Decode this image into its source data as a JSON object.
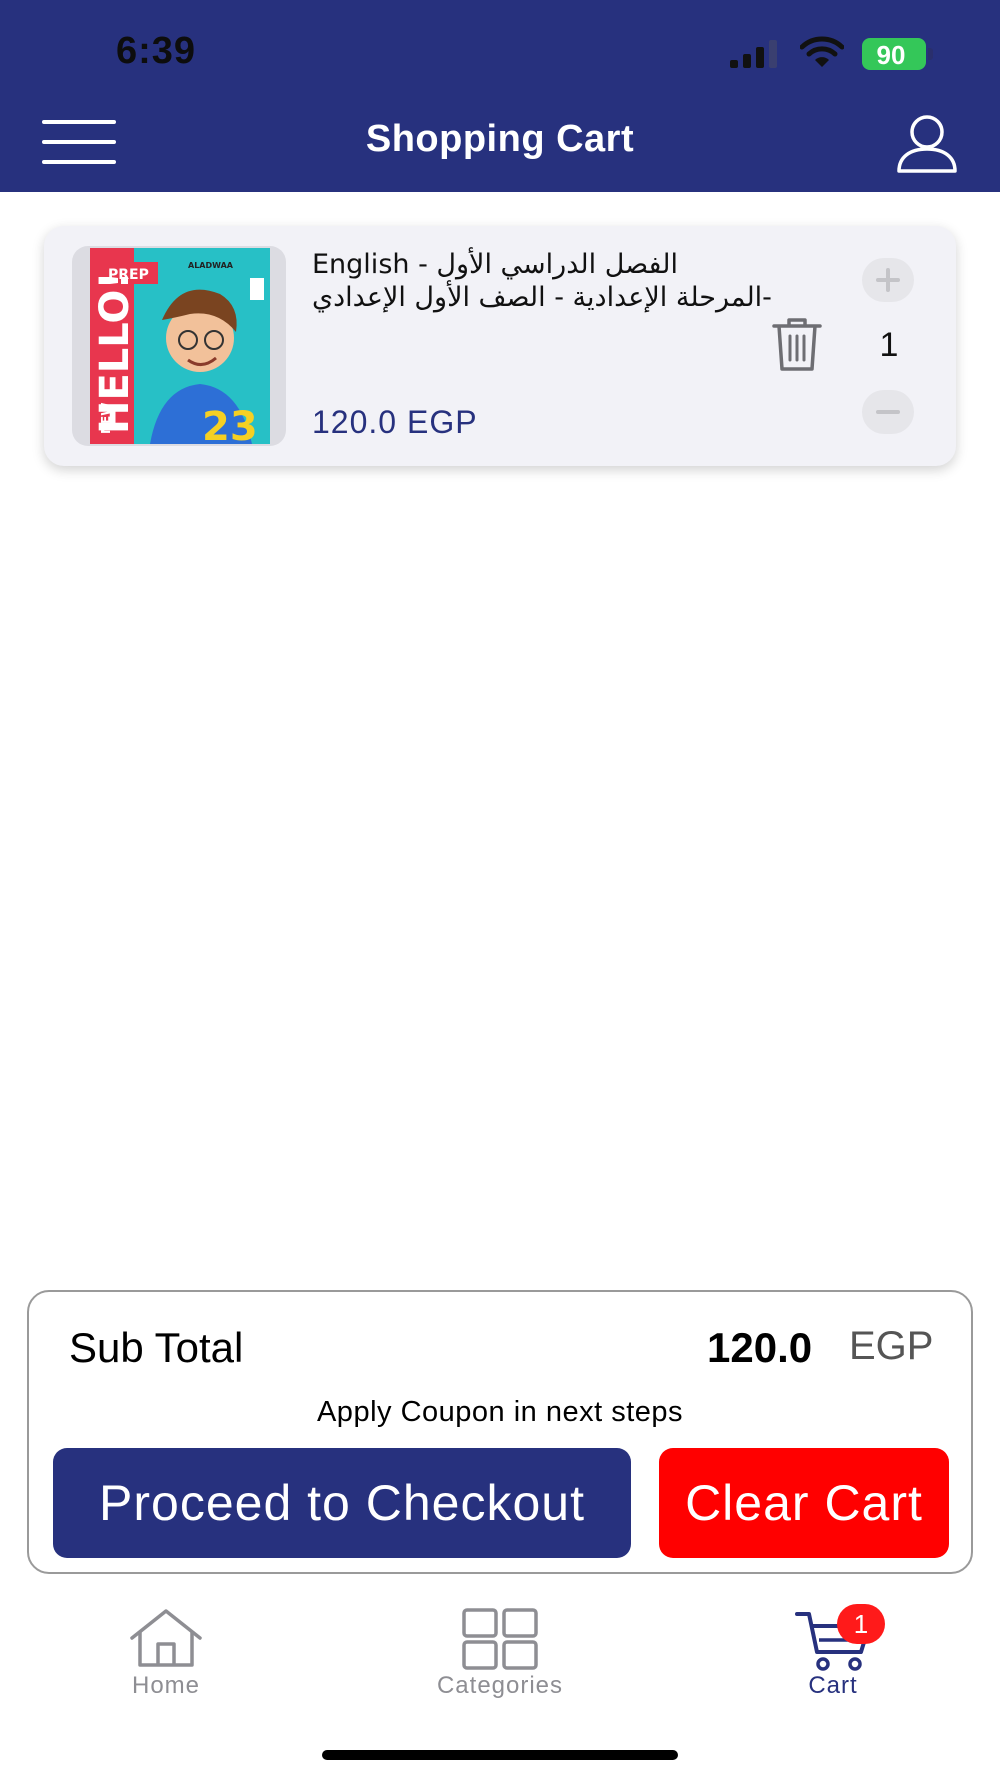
{
  "status_bar": {
    "time": "6:39",
    "battery": "90"
  },
  "header": {
    "title": "Shopping Cart",
    "menu_icon": "hamburger-menu-icon",
    "profile_icon": "user-profile-icon"
  },
  "cart_items": [
    {
      "title": "English - الفصل الدراسي الأول -المرحلة الإعدادية - الصف الأول الإعدادي",
      "price": "120.0",
      "currency": "EGP",
      "quantity": "1",
      "image_icon": "book-cover-image"
    }
  ],
  "summary": {
    "subtotal_label": "Sub Total",
    "subtotal_amount": "120.0",
    "subtotal_currency": "EGP",
    "coupon_note": "Apply Coupon in next steps",
    "checkout_label": "Proceed to Checkout",
    "clear_label": "Clear Cart"
  },
  "tab_bar": {
    "items": [
      {
        "label": "Home",
        "icon": "home-icon"
      },
      {
        "label": "Categories",
        "icon": "grid-icon"
      },
      {
        "label": "Cart",
        "icon": "cart-icon",
        "badge": "1",
        "active": true
      }
    ]
  },
  "colors": {
    "primary": "#27317e",
    "danger": "#ff0000",
    "badge": "#ff1a1a",
    "battery": "#34c759",
    "inactive_tab": "#8e8e93"
  }
}
